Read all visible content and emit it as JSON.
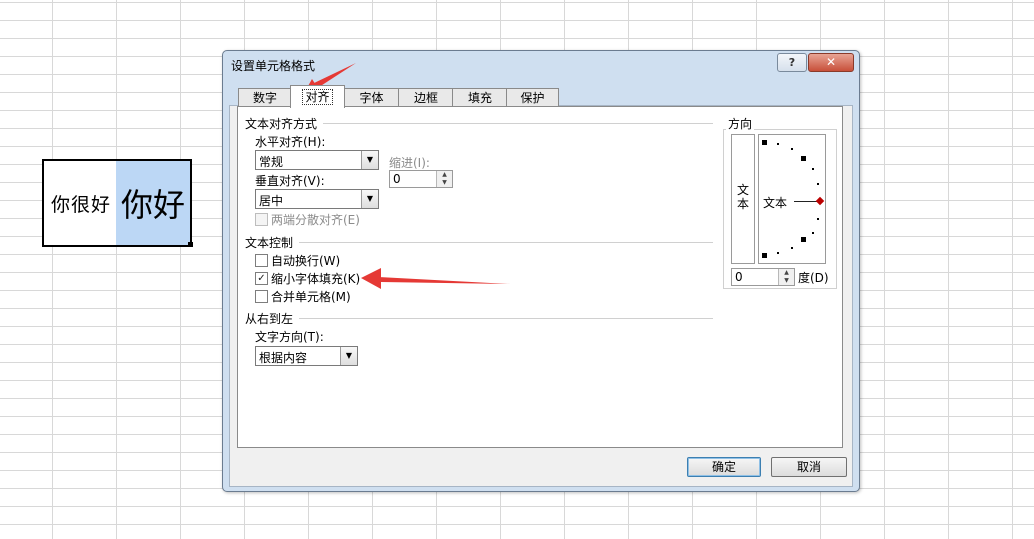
{
  "sheet": {
    "cell_left_text": "你很好",
    "cell_right_text": "你好"
  },
  "dialog": {
    "title": "设置单元格格式",
    "help_label": "?",
    "close_label": "✕",
    "tabs": [
      {
        "label": "数字"
      },
      {
        "label": "对齐"
      },
      {
        "label": "字体"
      },
      {
        "label": "边框"
      },
      {
        "label": "填充"
      },
      {
        "label": "保护"
      }
    ],
    "active_tab": "对齐",
    "text_alignment": {
      "title": "文本对齐方式",
      "horizontal_label": "水平对齐(H):",
      "horizontal_value": "常规",
      "indent_label": "缩进(I):",
      "indent_value": "0",
      "vertical_label": "垂直对齐(V):",
      "vertical_value": "居中",
      "justify_distributed_label": "两端分散对齐(E)"
    },
    "text_control": {
      "title": "文本控制",
      "wrap_label": "自动换行(W)",
      "wrap_checked": false,
      "shrink_label": "缩小字体填充(K)",
      "shrink_checked": true,
      "merge_label": "合并单元格(M)",
      "merge_checked": false
    },
    "rtl": {
      "title": "从右到左",
      "direction_label": "文字方向(T):",
      "direction_value": "根据内容"
    },
    "orientation": {
      "title": "方向",
      "vertical_text": "文本",
      "dial_text": "文本",
      "degrees_value": "0",
      "degrees_label": "度(D)"
    },
    "ok_label": "确定",
    "cancel_label": "取消"
  },
  "colors": {
    "selected_cell": "#bcd7f5",
    "annotation_arrow": "#e53935",
    "dialog_frame": "#cfdff0"
  }
}
